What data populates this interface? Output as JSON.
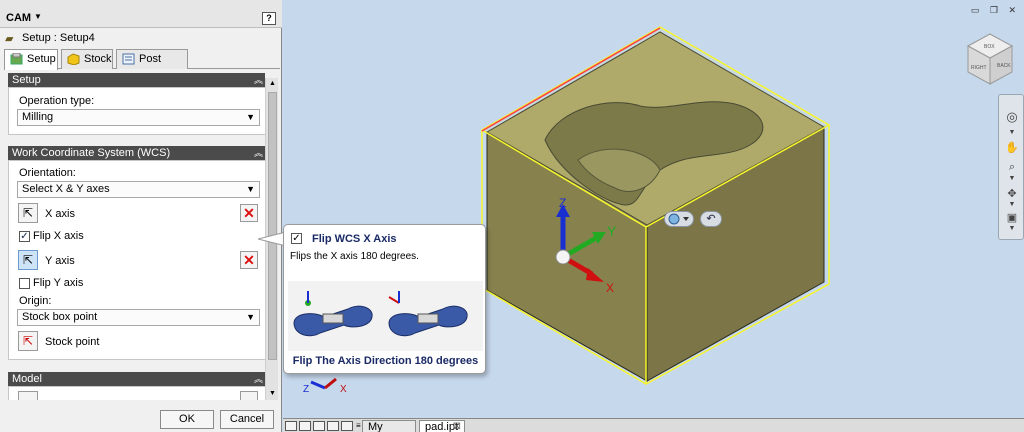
{
  "panel": {
    "title": "CAM",
    "subtitle": "Setup : Setup4",
    "help": "?",
    "tabs": [
      {
        "label": "Setup"
      },
      {
        "label": "Stock"
      },
      {
        "label": "Post Process"
      }
    ],
    "setup_section": {
      "title": "Setup",
      "operation_type_label": "Operation type:",
      "operation_type_value": "Milling"
    },
    "wcs_section": {
      "title": "Work Coordinate System (WCS)",
      "orientation_label": "Orientation:",
      "orientation_value": "Select X & Y axes",
      "x_axis_label": "X axis",
      "flip_x_label": "Flip X axis",
      "flip_x_checked": true,
      "y_axis_label": "Y axis",
      "flip_y_label": "Flip Y axis",
      "flip_y_checked": false,
      "origin_label": "Origin:",
      "origin_value": "Stock box point",
      "stock_point_label": "Stock point"
    },
    "model_section": {
      "title": "Model"
    },
    "ok_label": "OK",
    "cancel_label": "Cancel"
  },
  "tooltip": {
    "title": "Flip WCS X Axis",
    "description": "Flips the X axis 180 degrees.",
    "caption": "Flip The Axis Direction 180 degrees"
  },
  "viewport": {
    "axes": {
      "x": "X",
      "y": "Y",
      "z": "Z"
    },
    "viewcube": {
      "top": "BOX",
      "right": "BACK",
      "left": "RIGHT"
    }
  },
  "bottom_tabs": [
    {
      "label": "My Home",
      "active": false
    },
    {
      "label": "pad.ipt",
      "active": true
    }
  ],
  "colors": {
    "section_header": "#4b4b4b",
    "stock_box_edge": "#ffff33",
    "part_fill": "#8a8450",
    "x_axis": "#e01010",
    "y_axis": "#22aa22",
    "z_axis": "#1a2fd1",
    "viewport_bg": "#c6d8ec"
  }
}
